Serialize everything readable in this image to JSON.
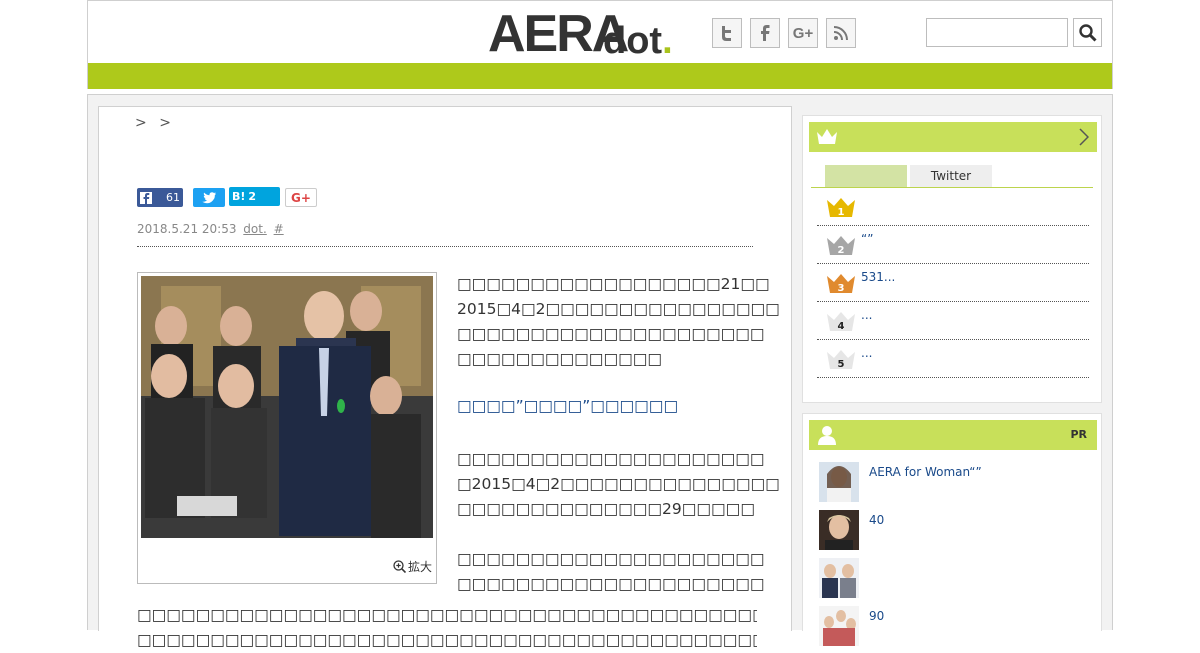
{
  "header": {
    "logo_main": "AERA",
    "logo_sub": "dot",
    "logo_period": ".",
    "social_icons": [
      "twitter-icon",
      "facebook-icon",
      "google-plus-icon",
      "rss-icon"
    ],
    "search_placeholder": ""
  },
  "colors": {
    "accent": "#aec91b",
    "panel_head": "#c8e05a",
    "link": "#1a4a8a"
  },
  "article": {
    "breadcrumb": [
      ">",
      ">"
    ],
    "share": {
      "facebook_count": "61",
      "hatena_label": "B!",
      "hatena_count": "2",
      "gplus_label": "G+"
    },
    "date": "2018.5.21 20:53",
    "source": "dot.",
    "hash": "#",
    "zoom_label": "拡大",
    "para1": [
      "□□□□□□□□□□□□□□□□□□21□□",
      "2015□4□2□□□□□□□□□□□□□□□□",
      "□□□□□□□□□□□□□□□□□□□□□",
      "□□□□□□□□□□□□□□"
    ],
    "subhead": "□□□□”□□□□”□□□□□□",
    "para2": [
      "□□□□□□□□□□□□□□□□□□□□□",
      "□2015□4□2□□□□□□□□□□□□□□□",
      "□□□□□□□□□□□□□□29□□□□□"
    ],
    "para3": [
      "□□□□□□□□□□□□□□□□□□□□□",
      "□□□□□□□□□□□□□□□□□□□□□"
    ],
    "para4": [
      "□□□□□□□□□□□□□□□□□□□□□□□□□□□□□□□□□□□□□□□□□□□",
      "□□□□□□□□□□□□□□□□□□□□□□□□□□□□□□□□□□□□□□□□□□□"
    ]
  },
  "ranking": {
    "head_icon": "crown-icon",
    "tabs": [
      "",
      "Twitter"
    ],
    "items": [
      {
        "rank": "1",
        "text": "",
        "color": "#e6b800"
      },
      {
        "rank": "2",
        "text": "“”",
        "color": "#a6a6a6"
      },
      {
        "rank": "3",
        "text": "531...",
        "color": "#e08a2e"
      },
      {
        "rank": "4",
        "text": "...",
        "color": "#dddddd"
      },
      {
        "rank": "5",
        "text": "...",
        "color": "#dddddd"
      }
    ]
  },
  "pr": {
    "head_icon": "person-icon",
    "label": "PR",
    "items": [
      {
        "text": "AERA for Woman“”"
      },
      {
        "text": "40"
      },
      {
        "text": ""
      },
      {
        "text": "90"
      }
    ]
  }
}
